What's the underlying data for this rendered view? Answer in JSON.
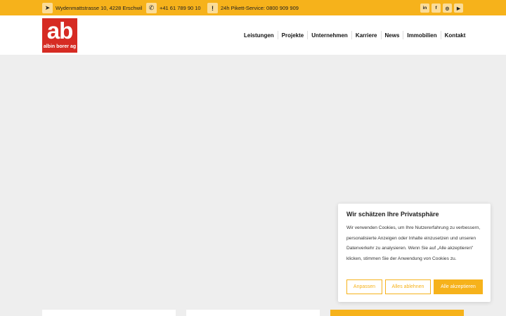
{
  "topbar": {
    "address": "Wydenmattstrasse 10, 4228 Erschwil",
    "phone": "+41 61 789 90 10",
    "pikett": "24h Pikett-Service: 0800 909 909",
    "social": [
      "in",
      "f",
      "◎",
      "▶"
    ]
  },
  "logo": {
    "mark": "ab",
    "name": "albin borer ag"
  },
  "nav": [
    "Leistungen",
    "Projekte",
    "Unternehmen",
    "Karriere",
    "News",
    "Immobilien",
    "Kontakt"
  ],
  "cookie": {
    "title": "Wir schätzen Ihre Privatsphäre",
    "text": "Wir verwenden Cookies, um Ihre Nutzererfahrung zu verbessern, personalisierte Anzeigen oder Inhalte einzusetzen und unseren Datenverkehr zu analysieren. Wenn Sie auf „Alle akzeptieren\" klicken, stimmen Sie der Anwendung von Cookies zu.",
    "customize": "Anpassen",
    "reject": "Alles ablehnen",
    "accept": "Alle akzeptieren"
  },
  "colors": {
    "accent": "#f6b21b",
    "logo": "#d62b23"
  }
}
